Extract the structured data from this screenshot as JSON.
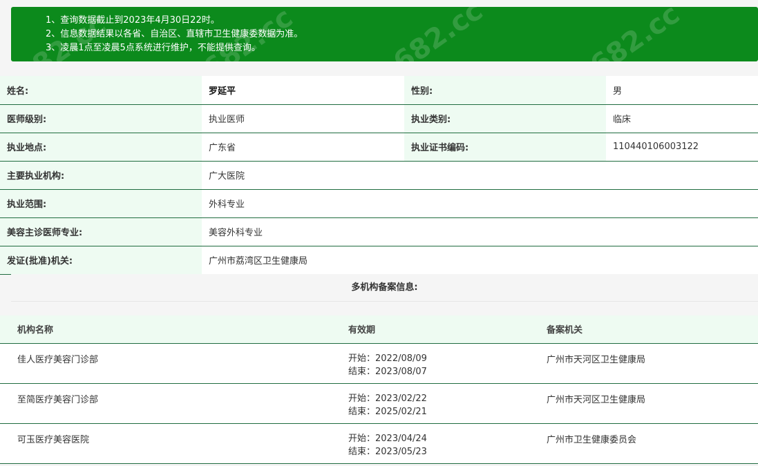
{
  "notice": {
    "lines": [
      "1、查询数据截止到2023年4月30日22时。",
      "2、信息数据结果以各省、自治区、直辖市卫生健康委数据为准。",
      "3、凌晨1点至凌晨5点系统进行维护，不能提供查询。"
    ],
    "watermark": "682.cc"
  },
  "info": {
    "name_label": "姓名:",
    "name_value": "罗延平",
    "gender_label": "性别:",
    "gender_value": "男",
    "level_label": "医师级别:",
    "level_value": "执业医师",
    "category_label": "执业类别:",
    "category_value": "临床",
    "location_label": "执业地点:",
    "location_value": "广东省",
    "cert_label": "执业证书编码:",
    "cert_value": "110440106003122",
    "institution_label": "主要执业机构:",
    "institution_value": "广大医院",
    "scope_label": "执业范围:",
    "scope_value": "外科专业",
    "cosmetic_label": "美容主诊医师专业:",
    "cosmetic_value": "美容外科专业",
    "authority_label": "发证(批准)机关:",
    "authority_value": "广州市荔湾区卫生健康局"
  },
  "multi": {
    "title": "多机构备案信息:",
    "headers": [
      "机构名称",
      "有效期",
      "备案机关"
    ],
    "rows": [
      {
        "name": "佳人医疗美容门诊部",
        "start": "开始：2022/08/09",
        "end": "结束：2023/08/07",
        "authority": "广州市天河区卫生健康局"
      },
      {
        "name": "至简医疗美容门诊部",
        "start": "开始：2023/02/22",
        "end": "结束：2025/02/21",
        "authority": "广州市天河区卫生健康局"
      },
      {
        "name": "可玉医疗美容医院",
        "start": "开始：2023/04/24",
        "end": "结束：2023/05/23",
        "authority": "广州市卫生健康委员会"
      }
    ]
  },
  "colors": {
    "notice_bg": "#0c8a1c",
    "label_bg": "#eefbf2",
    "row_border": "#1e6b3e"
  }
}
